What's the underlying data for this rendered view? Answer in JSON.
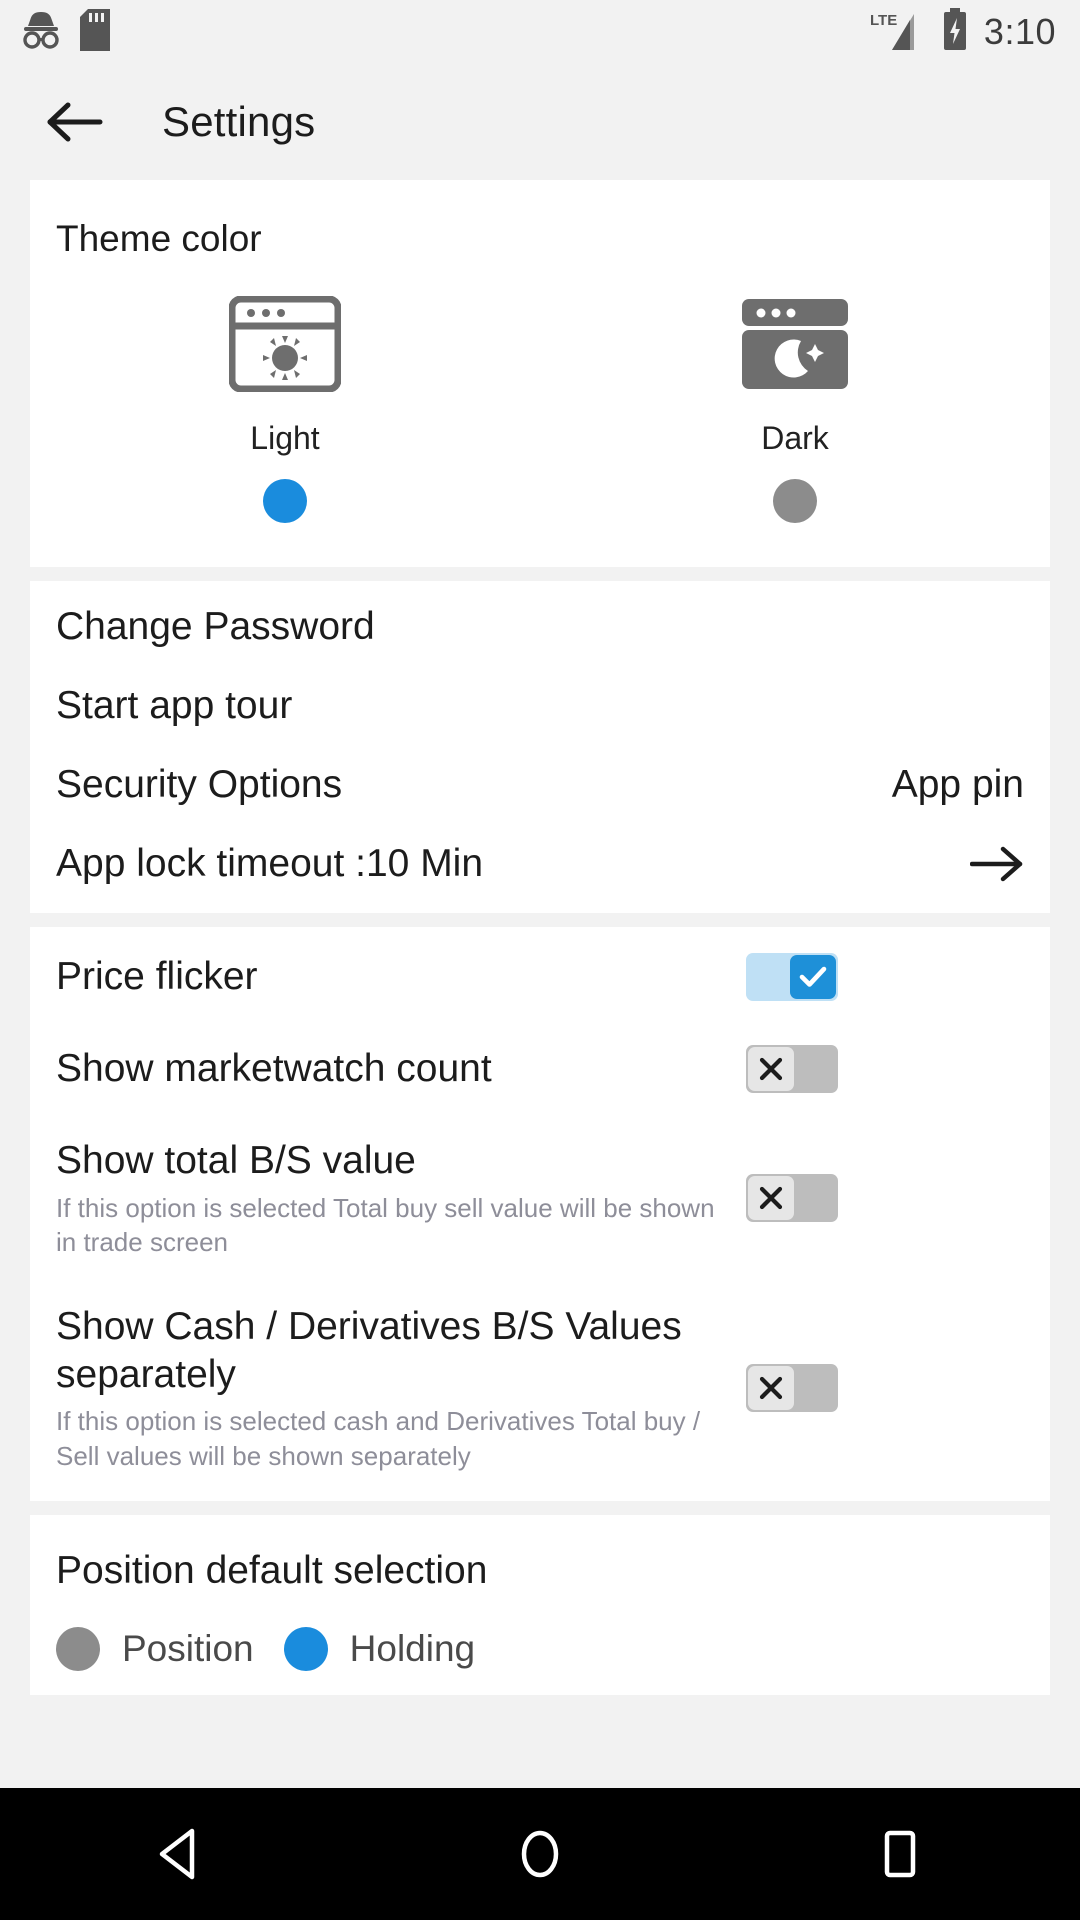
{
  "statusbar": {
    "icons": [
      "incognito-icon",
      "sd-card-icon",
      "lte-signal-icon",
      "battery-charging-icon"
    ],
    "network_label": "LTE",
    "time": "3:10"
  },
  "appbar": {
    "back_icon": "back-arrow-icon",
    "title": "Settings"
  },
  "theme": {
    "title": "Theme color",
    "options": [
      {
        "label": "Light",
        "icon": "light-theme-window-icon",
        "selected": true
      },
      {
        "label": "Dark",
        "icon": "dark-theme-window-icon",
        "selected": false
      }
    ]
  },
  "general": {
    "items": [
      {
        "label": "Change Password",
        "value": "",
        "arrow": false
      },
      {
        "label": "Start app tour",
        "value": "",
        "arrow": false
      },
      {
        "label": "Security Options",
        "value": "App pin",
        "arrow": false
      },
      {
        "label": "App lock timeout :10 Min",
        "value": "",
        "arrow": true
      }
    ]
  },
  "toggles": {
    "items": [
      {
        "title": "Price flicker",
        "subtitle": "",
        "state": "on",
        "glyph": "check-icon"
      },
      {
        "title": "Show marketwatch count",
        "subtitle": "",
        "state": "off",
        "glyph": "close-icon"
      },
      {
        "title": "Show total B/S value",
        "subtitle": "If this option is selected Total buy sell value will be shown in trade screen",
        "state": "off",
        "glyph": "close-icon"
      },
      {
        "title": "Show Cash / Derivatives B/S Values separately",
        "subtitle": "If this option is selected cash and Derivatives Total buy / Sell values will be shown separately",
        "state": "off",
        "glyph": "close-icon"
      }
    ]
  },
  "position_default": {
    "title": "Position default selection",
    "options": [
      {
        "label": "Position",
        "selected": false
      },
      {
        "label": "Holding",
        "selected": true
      }
    ]
  },
  "navbar": {
    "buttons": [
      {
        "name": "back-nav-button",
        "icon": "triangle-back-icon"
      },
      {
        "name": "home-nav-button",
        "icon": "circle-home-icon"
      },
      {
        "name": "recents-nav-button",
        "icon": "square-recents-icon"
      }
    ]
  },
  "colors": {
    "accent_blue": "#1a8cdd",
    "toggle_on_track": "#bfe0f5",
    "toggle_on_thumb": "#1e90d8",
    "toggle_off_track": "#bdbdbd",
    "toggle_off_thumb": "#e6e6e6",
    "radio_unselected": "#8c8c8c",
    "page_background": "#f2f2f2",
    "card_background": "#ffffff",
    "subtitle_gray": "#8e8e99"
  }
}
